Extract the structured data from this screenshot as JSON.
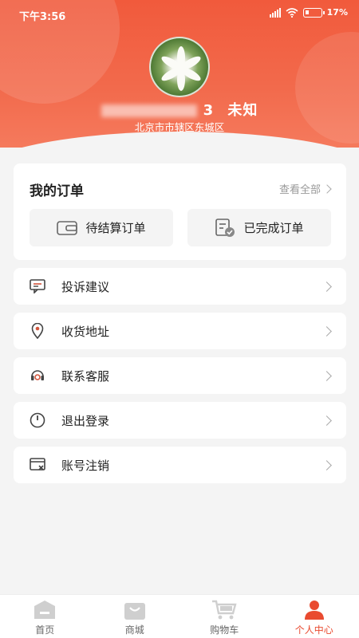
{
  "status": {
    "time": "下午3:56",
    "battery": "17%"
  },
  "profile": {
    "name_suffix": "3",
    "gender": "未知",
    "region": "北京市市辖区东城区"
  },
  "orders": {
    "title": "我的订单",
    "view_all": "查看全部",
    "pending_label": "待结算订单",
    "completed_label": "已完成订单"
  },
  "menu": [
    {
      "label": "投诉建议",
      "icon": "message-icon"
    },
    {
      "label": "收货地址",
      "icon": "location-pin-icon"
    },
    {
      "label": "联系客服",
      "icon": "headset-icon"
    },
    {
      "label": "退出登录",
      "icon": "power-icon"
    },
    {
      "label": "账号注销",
      "icon": "account-cancel-icon"
    }
  ],
  "tabs": [
    {
      "label": "首页",
      "icon": "home-icon"
    },
    {
      "label": "商城",
      "icon": "shopping-bag-icon"
    },
    {
      "label": "购物车",
      "icon": "cart-icon"
    },
    {
      "label": "个人中心",
      "icon": "user-icon",
      "active": true
    }
  ],
  "colors": {
    "accent": "#e94b30",
    "header": "#f26a4c"
  }
}
